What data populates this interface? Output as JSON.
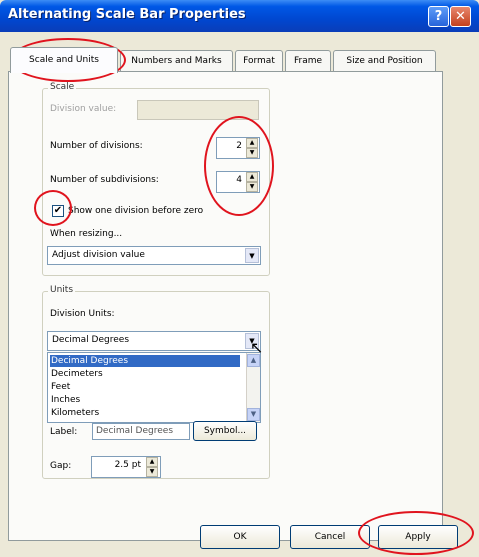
{
  "window": {
    "title": "Alternating Scale Bar Properties",
    "help_glyph": "?",
    "close_glyph": "✕"
  },
  "tabs": [
    {
      "label": "Scale and Units",
      "active": true
    },
    {
      "label": "Numbers and Marks",
      "active": false
    },
    {
      "label": "Format",
      "active": false
    },
    {
      "label": "Frame",
      "active": false
    },
    {
      "label": "Size and Position",
      "active": false
    }
  ],
  "scale": {
    "group_label": "Scale",
    "division_value_label": "Division value:",
    "division_value": "",
    "num_divisions_label": "Number of divisions:",
    "num_divisions": "2",
    "num_subdivisions_label": "Number of subdivisions:",
    "num_subdivisions": "4",
    "show_one_division_label": "Show one division before zero",
    "show_one_division_checked": true,
    "check_glyph": "✔",
    "when_resizing_label": "When resizing...",
    "when_resizing_value": "Adjust division value"
  },
  "units": {
    "group_label": "Units",
    "division_units_label": "Division Units:",
    "division_units_value": "Decimal Degrees",
    "options": [
      "Decimal Degrees",
      "Decimeters",
      "Feet",
      "Inches",
      "Kilometers"
    ],
    "selected_option": "Decimal Degrees",
    "label_label": "Label:",
    "label_value": "Decimal Degrees",
    "symbol_button": "Symbol...",
    "gap_label": "Gap:",
    "gap_value": "2.5 pt"
  },
  "buttons": {
    "ok": "OK",
    "cancel": "Cancel",
    "apply": "Apply"
  },
  "colors": {
    "annotation_circle": "#e0141e",
    "selection": "#316ac5",
    "titlebar": "#0058e6"
  }
}
